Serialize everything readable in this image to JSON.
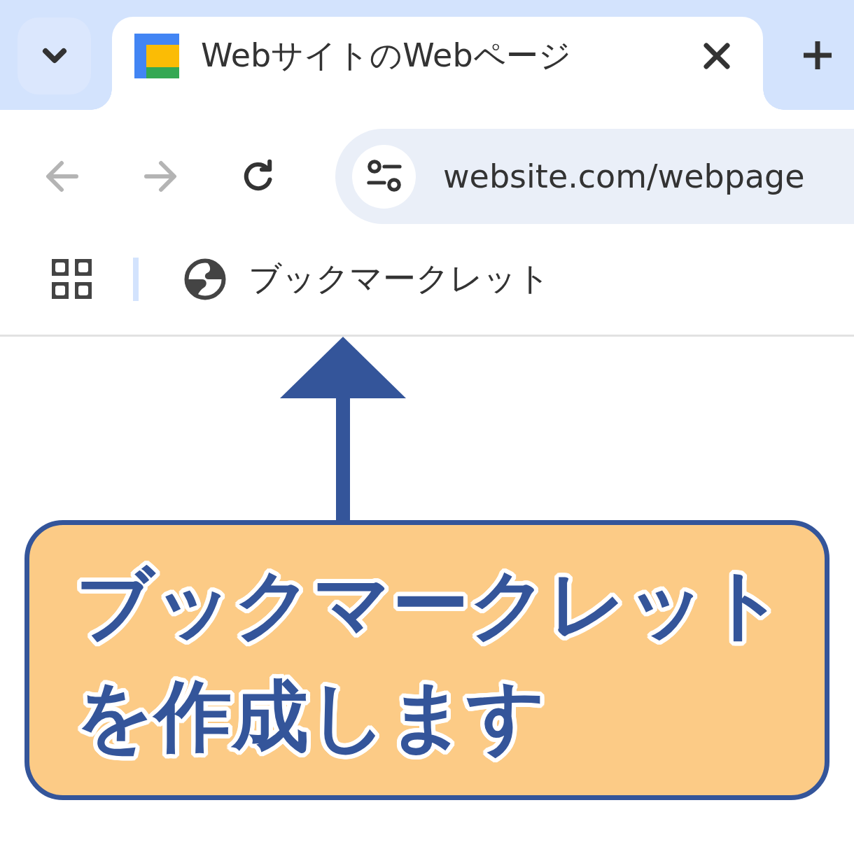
{
  "tab_strip": {
    "tabs": [
      {
        "title": "WebサイトのWebページ",
        "selected": true
      }
    ]
  },
  "toolbar": {
    "nav_buttons": [
      {
        "kind": "back",
        "disabled": true
      },
      {
        "kind": "forward",
        "disabled": true
      },
      {
        "kind": "reload",
        "disabled": false
      }
    ],
    "address_bar": {
      "url": "website.com/webpage"
    }
  },
  "bookmarks_bar": {
    "items": [
      {
        "title": "ブックマークレット"
      }
    ]
  },
  "callout": {
    "text": "ブックマークレットを作成します"
  }
}
